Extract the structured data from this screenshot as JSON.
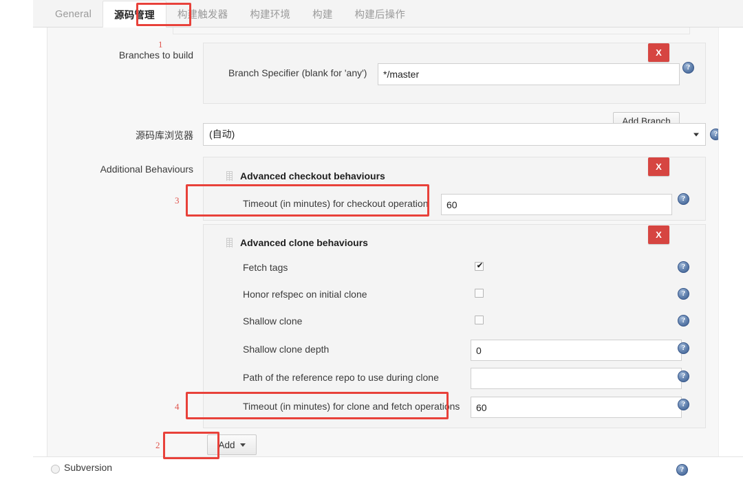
{
  "window": {
    "app": "Jenkins Job Configuration",
    "accent_red": "#e8413a",
    "delete_button_red": "#d64541",
    "help_icon_blue": "#3d5f91"
  },
  "tabs": [
    {
      "label": "General",
      "active": false
    },
    {
      "label": "源码管理",
      "active": true
    },
    {
      "label": "构建触发器",
      "active": false
    },
    {
      "label": "构建环境",
      "active": false
    },
    {
      "label": "构建",
      "active": false
    },
    {
      "label": "构建后操作",
      "active": false
    }
  ],
  "annotations": [
    {
      "number": "1",
      "target": "branches-to-build"
    },
    {
      "number": "2",
      "target": "add-behaviour-button"
    },
    {
      "number": "3",
      "target": "checkout-timeout-field"
    },
    {
      "number": "4",
      "target": "clone-fetch-timeout-field"
    }
  ],
  "branches_section": {
    "label": "Branches to build",
    "branch_specifier_label": "Branch Specifier (blank for 'any')",
    "branch_specifier_value": "*/master",
    "branch_specifier_placeholder": "",
    "add_branch_label": "Add Branch",
    "delete_label": "X",
    "help_label": "?"
  },
  "repo_browser_section": {
    "label": "源码库浏览器",
    "selected_option": "(自动)",
    "help_label": "?"
  },
  "additional_behaviours": {
    "label": "Additional Behaviours",
    "add_label": "Add",
    "checkout_behaviours": {
      "title": "Advanced checkout behaviours",
      "delete_label": "X",
      "fields": [
        {
          "label": "Timeout (in minutes) for checkout operation",
          "value": "60",
          "type": "text",
          "help_label": "?"
        }
      ]
    },
    "clone_behaviours": {
      "title": "Advanced clone behaviours",
      "delete_label": "X",
      "fields": [
        {
          "label": "Fetch tags",
          "type": "checkbox",
          "checked": true,
          "help_label": "?"
        },
        {
          "label": "Honor refspec on initial clone",
          "type": "checkbox",
          "checked": false,
          "help_label": "?"
        },
        {
          "label": "Shallow clone",
          "type": "checkbox",
          "checked": false,
          "help_label": "?"
        },
        {
          "label": "Shallow clone depth",
          "type": "text",
          "value": "0",
          "help_label": "?"
        },
        {
          "label": "Path of the reference repo to use during clone",
          "type": "text",
          "value": "",
          "help_label": "?"
        },
        {
          "label": "Timeout (in minutes) for clone and fetch operations",
          "type": "text",
          "value": "60",
          "help_label": "?"
        }
      ]
    }
  },
  "scm_options": {
    "subversion": {
      "label": "Subversion",
      "selected": false,
      "help_label": "?"
    }
  }
}
